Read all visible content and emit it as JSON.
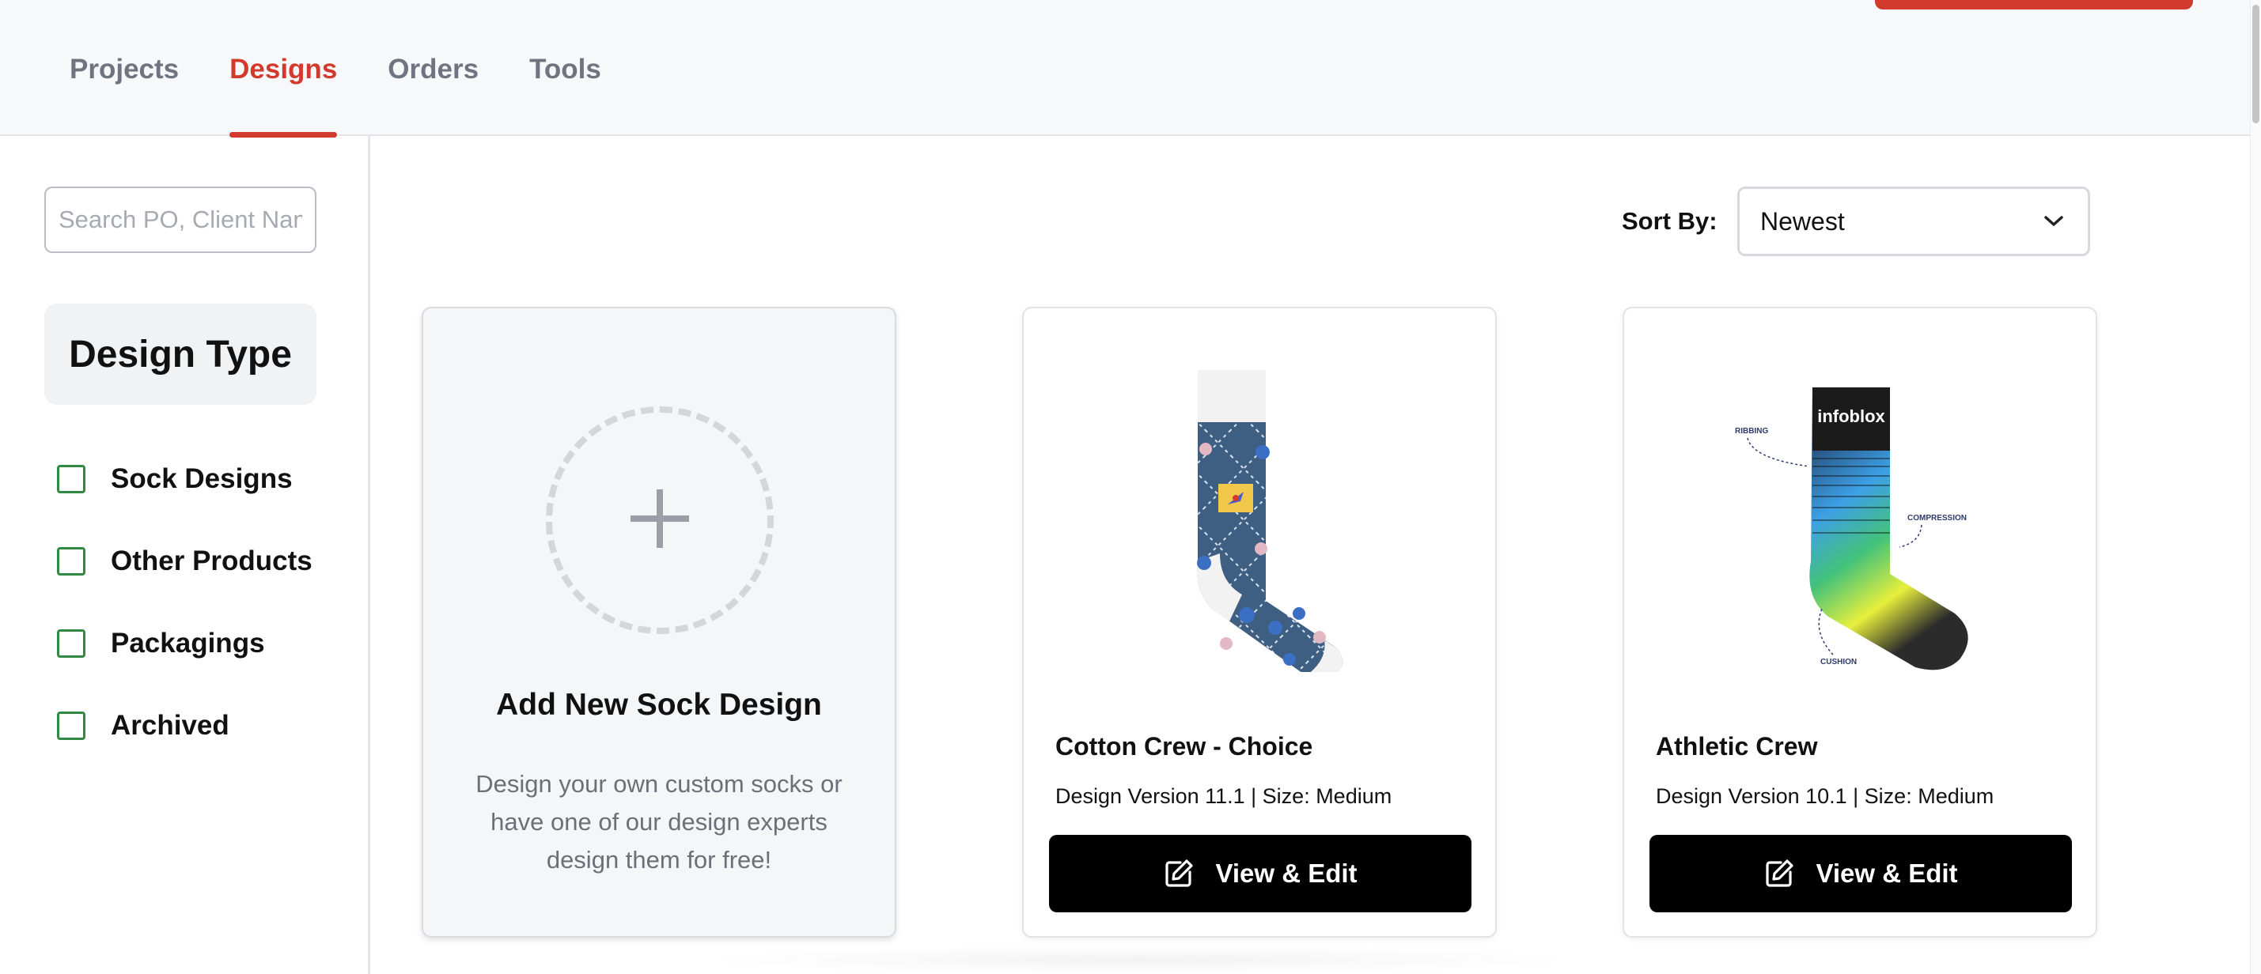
{
  "nav": {
    "tabs": [
      {
        "label": "Projects",
        "active": false
      },
      {
        "label": "Designs",
        "active": true
      },
      {
        "label": "Orders",
        "active": false
      },
      {
        "label": "Tools",
        "active": false
      }
    ]
  },
  "colors": {
    "accent": "#d23a2e",
    "checkbox": "#2f8a45",
    "button": "#000000"
  },
  "sidebar": {
    "search_placeholder": "Search PO, Client Name",
    "filter_heading": "Design Type",
    "filters": [
      {
        "label": "Sock Designs",
        "checked": false
      },
      {
        "label": "Other Products",
        "checked": false
      },
      {
        "label": "Packagings",
        "checked": false
      },
      {
        "label": "Archived",
        "checked": false
      }
    ]
  },
  "sort": {
    "label": "Sort By:",
    "selected": "Newest"
  },
  "add_card": {
    "title": "Add New Sock Design",
    "description": "Design your own custom socks or have one of our design experts design them for free!"
  },
  "designs": [
    {
      "title": "Cotton Crew - Choice",
      "subtitle": "Design Version 11.1 | Size: Medium",
      "button_label": "View & Edit",
      "image_icon": "navy-basketball-sock-icon"
    },
    {
      "title": "Athletic Crew",
      "subtitle": "Design Version 10.1 | Size: Medium",
      "button_label": "View & Edit",
      "image_icon": "gradient-athletic-sock-icon",
      "sock_labels": {
        "brand": "infoblox",
        "ribbing": "RIBBING",
        "compression": "COMPRESSION",
        "cushion": "CUSHION"
      }
    }
  ]
}
